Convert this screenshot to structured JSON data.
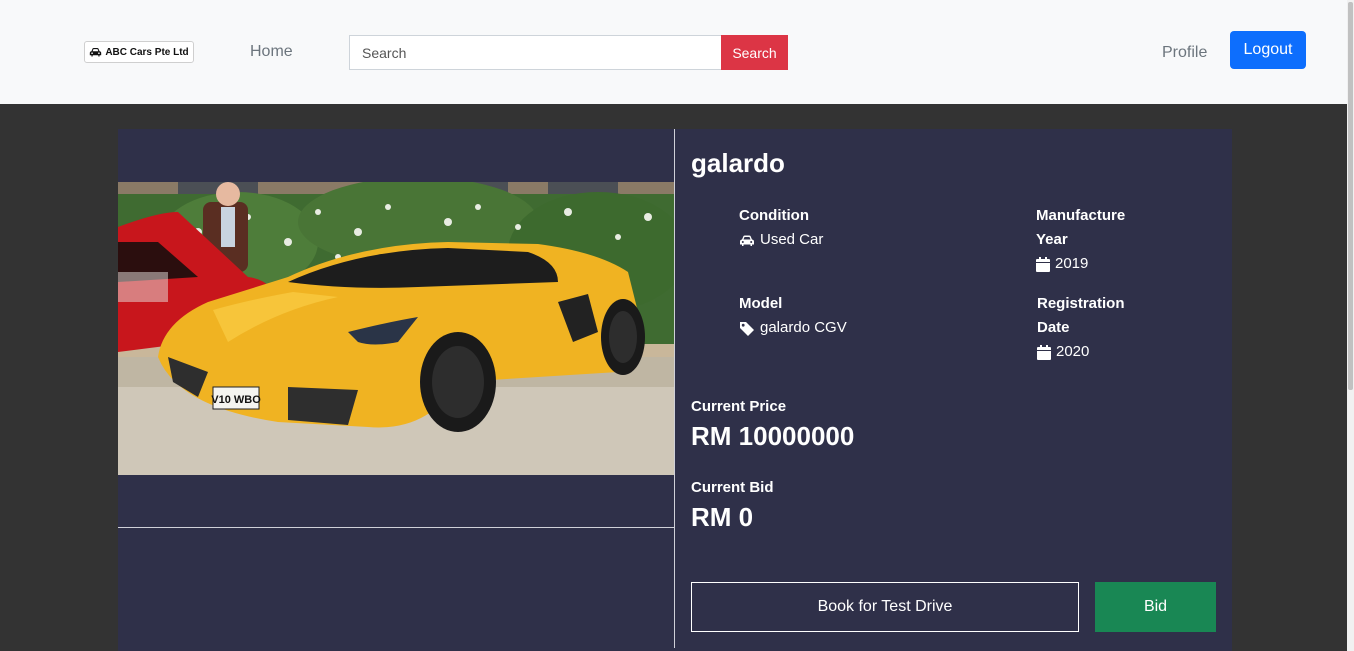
{
  "navbar": {
    "brand": "ABC Cars Pte Ltd",
    "brand_icon": "car-icon",
    "home": "Home",
    "search_placeholder": "Search",
    "search_button": "Search",
    "profile": "Profile",
    "logout": "Logout"
  },
  "car": {
    "title": "galardo",
    "image_alt": "yellow sports car",
    "specs": {
      "condition": {
        "label": "Condition",
        "value": "Used Car",
        "icon": "car-icon"
      },
      "manufacture_year": {
        "label": "Manufacture Year",
        "value": "2019",
        "icon": "calendar-icon"
      },
      "model": {
        "label": "Model",
        "value": "galardo CGV",
        "icon": "tag-icon"
      },
      "registration_date": {
        "label": "Registration Date",
        "value": "2020",
        "icon": "calendar-icon"
      }
    },
    "current_price": {
      "label": "Current Price",
      "value": "RM 10000000"
    },
    "current_bid": {
      "label": "Current Bid",
      "value": "RM 0"
    }
  },
  "actions": {
    "test_drive": "Book for Test Drive",
    "bid": "Bid"
  },
  "colors": {
    "navbar_bg": "#f8f9fa",
    "page_bg": "#333333",
    "card_bg": "#2f3049",
    "search_button": "#dc3545",
    "logout_button": "#0d6efd",
    "bid_button": "#198754"
  }
}
